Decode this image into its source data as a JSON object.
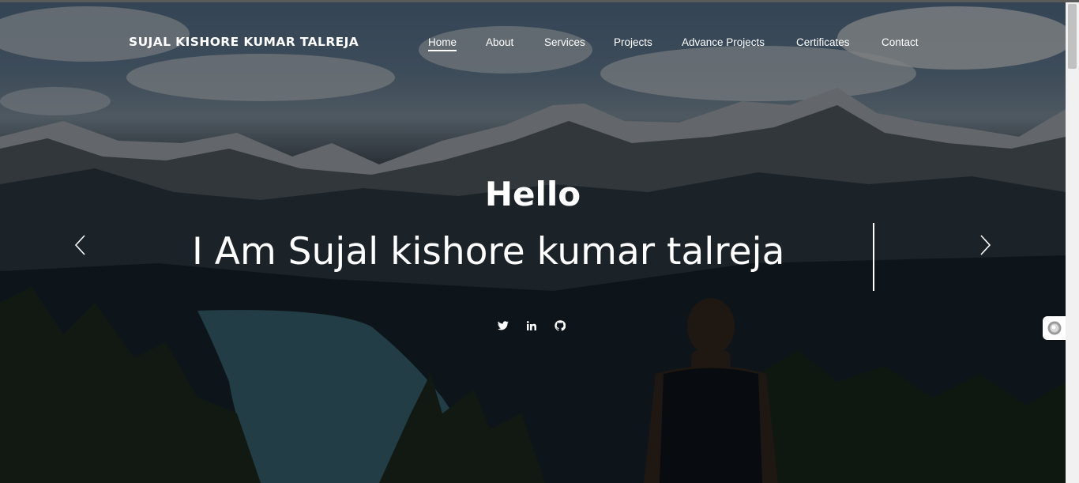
{
  "brand": {
    "name": "SUJAL KISHORE KUMAR TALREJA"
  },
  "nav": {
    "items": [
      {
        "label": "Home",
        "active": true
      },
      {
        "label": "About"
      },
      {
        "label": "Services"
      },
      {
        "label": "Projects"
      },
      {
        "label": "Advance Projects"
      },
      {
        "label": "Certificates"
      },
      {
        "label": "Contact"
      }
    ]
  },
  "hero": {
    "greeting": "Hello",
    "tagline": "I Am Sujal kishore kumar talreja"
  },
  "carousel": {
    "prev_icon": "chevron-left-icon",
    "next_icon": "chevron-right-icon"
  },
  "social": [
    {
      "icon": "twitter-icon"
    },
    {
      "icon": "linkedin-icon"
    },
    {
      "icon": "github-icon"
    }
  ],
  "colors": {
    "text": "#ffffff",
    "overlay": "rgba(0,0,0,0.45)"
  }
}
